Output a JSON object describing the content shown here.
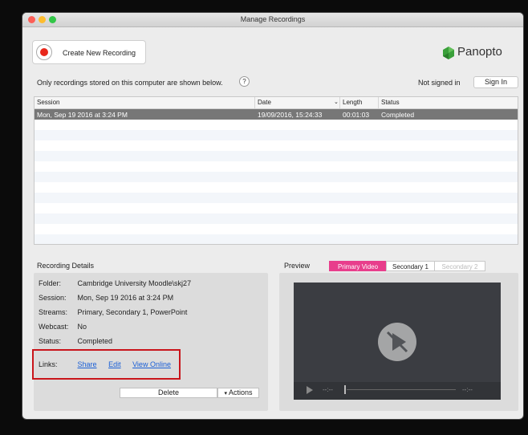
{
  "window": {
    "title": "Manage Recordings"
  },
  "toolbar": {
    "create_label": "Create New Recording"
  },
  "brand": {
    "logo_text": "Panopto"
  },
  "notice": {
    "text": "Only recordings stored on this computer are shown below.",
    "help": "?"
  },
  "account": {
    "status": "Not signed in",
    "sign_in": "Sign In"
  },
  "table": {
    "headers": {
      "session": "Session",
      "date": "Date",
      "length": "Length",
      "status": "Status"
    },
    "rows": [
      {
        "session": "Mon, Sep 19 2016 at 3:24 PM",
        "date": "19/09/2016, 15:24:33",
        "length": "00:01:03",
        "status": "Completed"
      }
    ]
  },
  "details": {
    "title": "Recording Details",
    "folder_label": "Folder:",
    "folder": "Cambridge University Moodle\\skj27",
    "session_label": "Session:",
    "session": "Mon, Sep 19 2016 at 3:24 PM",
    "streams_label": "Streams:",
    "streams": "Primary, Secondary 1, PowerPoint",
    "webcast_label": "Webcast:",
    "webcast": "No",
    "status_label": "Status:",
    "status": "Completed",
    "links_label": "Links:",
    "share": "Share",
    "edit": "Edit",
    "view_online": "View Online",
    "delete": "Delete",
    "actions": "Actions"
  },
  "preview": {
    "title": "Preview",
    "tabs": [
      "Primary Video",
      "Secondary 1",
      "Secondary 2"
    ],
    "time_current": "--:--",
    "time_total": "--:--"
  },
  "colors": {
    "accent_tab": "#e83e8c",
    "record": "#e8271b",
    "highlight_box": "#c9151b",
    "link": "#1a5fd6",
    "logo_green": "#3aa03a"
  }
}
